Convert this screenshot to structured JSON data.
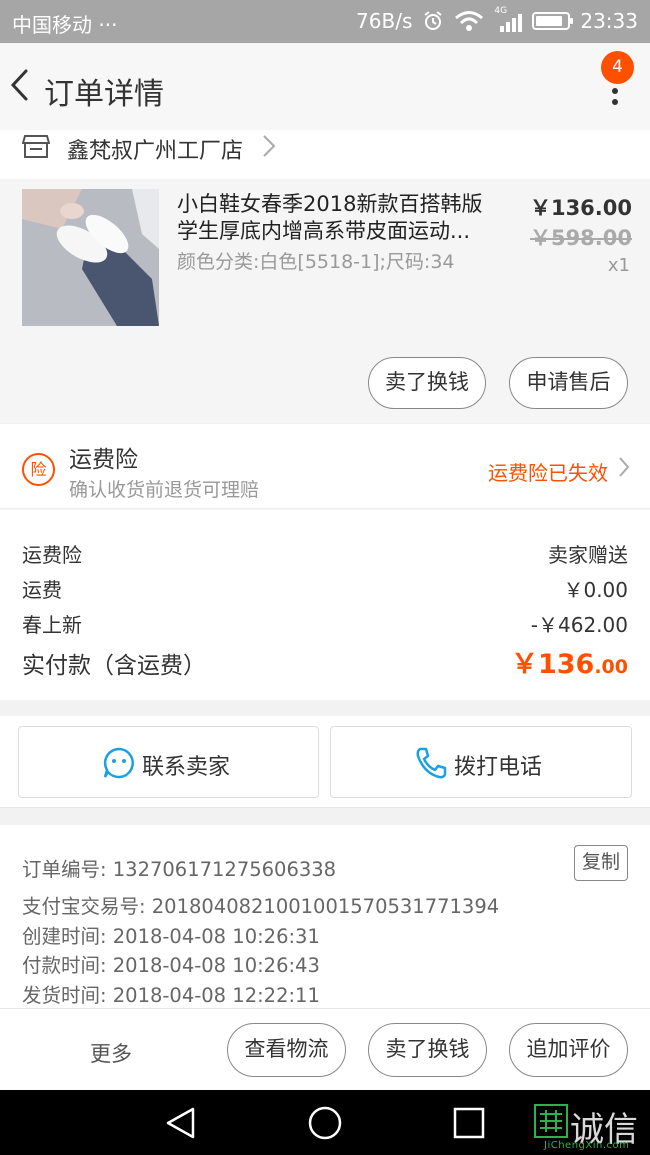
{
  "status_bar": {
    "carrier": "中国移动 ···",
    "speed": "76B/s",
    "network": "4G",
    "time": "23:33",
    "battery_level": 0.85
  },
  "nav": {
    "title": "订单详情",
    "badge_count": "4"
  },
  "store": {
    "name": "鑫梵叔广州工厂店"
  },
  "item": {
    "name_line1": "小白鞋女春季2018新款百搭韩版",
    "name_line2": "学生厚底内增高系带皮面运动...",
    "sku": "颜色分类:白色[5518-1];尺码:34",
    "price": "￥136.00",
    "original_price": "￥598.00",
    "quantity": "x1",
    "actions": [
      "卖了换钱",
      "申请售后"
    ]
  },
  "insurance": {
    "icon_text": "险",
    "title": "运费险",
    "subtitle": "确认收货前退货可理赔",
    "status": "运费险已失效"
  },
  "fees": [
    {
      "label": "运费险",
      "value": "卖家赠送"
    },
    {
      "label": "运费",
      "value": "￥0.00"
    },
    {
      "label": "春上新",
      "value": "-￥462.00"
    }
  ],
  "total": {
    "label": "实付款（含运费）",
    "currency": "￥",
    "integer": "136",
    "decimal": ".00"
  },
  "contact": {
    "seller_label": "联系卖家",
    "phone_label": "拨打电话"
  },
  "order_info": {
    "rows": [
      "订单编号: 132706171275606338",
      "支付宝交易号: 2018040821001001570531771394",
      "创建时间: 2018-04-08 10:26:31",
      "付款时间: 2018-04-08 10:26:43",
      "发货时间: 2018-04-08 12:22:11"
    ],
    "copy_label": "复制"
  },
  "bottom_bar": {
    "more": "更多",
    "buttons": [
      "查看物流",
      "卖了换钱",
      "追加评价"
    ]
  },
  "watermark": {
    "cn": "诚信",
    "en": "JiChengXin.com"
  },
  "colors": {
    "accent": "#ff5000",
    "statusbar": "#a6a6a6",
    "contact_icon": "#1aa0e6"
  }
}
